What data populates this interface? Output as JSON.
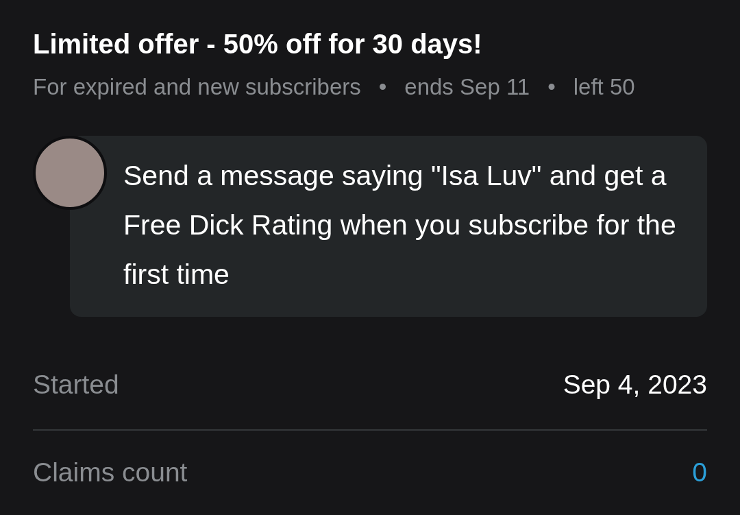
{
  "offer": {
    "title": "Limited offer - 50% off for 30 days!",
    "details": [
      "For expired and new subscribers",
      "ends Sep 11",
      "left 50"
    ],
    "separator": "•"
  },
  "message": {
    "text": "Send a message saying \"Isa Luv\" and get a Free Dick Rating when you subscribe for the first time"
  },
  "stats": [
    {
      "label": "Started",
      "value": "Sep 4, 2023",
      "kind": "plain"
    },
    {
      "label": "Claims count",
      "value": "0",
      "kind": "link"
    }
  ]
}
